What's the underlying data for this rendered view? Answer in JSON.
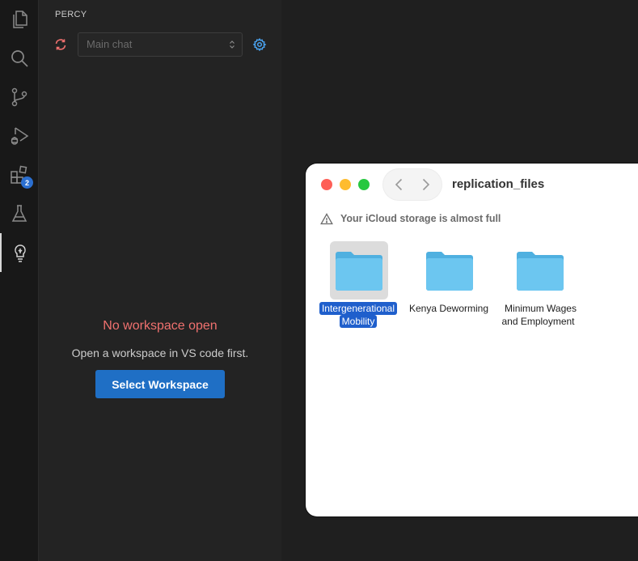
{
  "activity_bar": {
    "items": [
      {
        "name": "explorer",
        "icon": "files-icon"
      },
      {
        "name": "search",
        "icon": "search-icon"
      },
      {
        "name": "source-control",
        "icon": "source-control-icon"
      },
      {
        "name": "run-debug",
        "icon": "run-debug-icon"
      },
      {
        "name": "extensions",
        "icon": "extensions-icon",
        "badge": "2"
      },
      {
        "name": "testing",
        "icon": "flask-icon"
      },
      {
        "name": "percy",
        "icon": "lightbulb-icon",
        "active": true
      }
    ]
  },
  "panel": {
    "title": "PERCY",
    "chat_select": {
      "placeholder": "Main chat",
      "icon": "chevron-up-down-icon"
    },
    "refresh_icon": "refresh-icon",
    "settings_icon": "gear-icon",
    "empty_title": "No workspace open",
    "empty_desc": "Open a workspace in VS code first.",
    "select_button": "Select Workspace"
  },
  "finder": {
    "title": "replication_files",
    "warning": "Your iCloud storage is almost full",
    "items": [
      {
        "label": "Intergenerational Mobility",
        "selected": true
      },
      {
        "label": "Kenya Deworming",
        "selected": false
      },
      {
        "label": "Minimum Wages and Employment",
        "selected": false
      }
    ]
  },
  "colors": {
    "accent": "#1f6fc5",
    "error_text": "#f0716f",
    "selection": "#1f5fcc",
    "folder": "#5bbdea",
    "badge": "#2b6fd0"
  }
}
